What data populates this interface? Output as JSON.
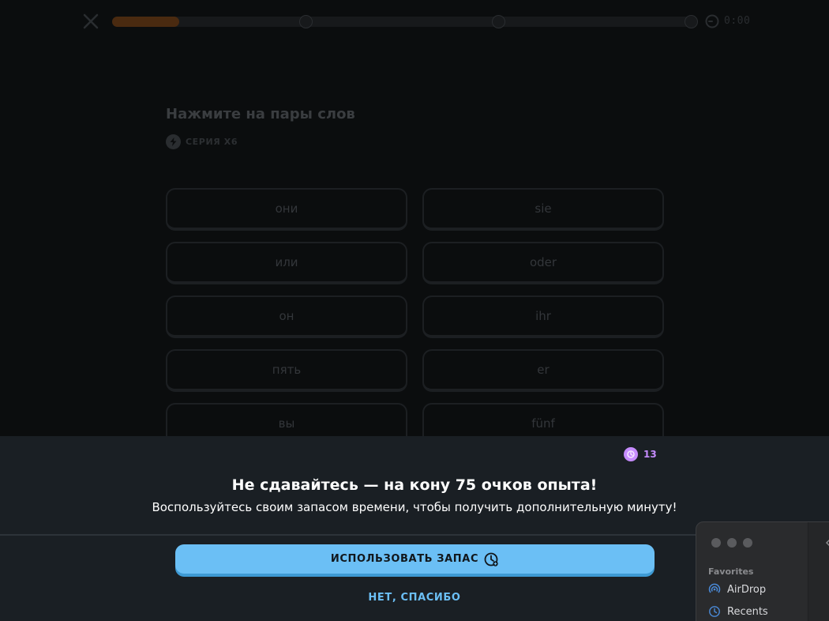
{
  "lesson": {
    "progress": 0.115,
    "timer": "0:00",
    "title": "Нажмите на пары слов",
    "streak_label": "СЕРИЯ X6",
    "tiles": [
      {
        "left": "они",
        "right": "sie"
      },
      {
        "left": "или",
        "right": "oder"
      },
      {
        "left": "он",
        "right": "ihr"
      },
      {
        "left": "пять",
        "right": "er"
      },
      {
        "left": "вы",
        "right": "fünf"
      }
    ]
  },
  "modal": {
    "gem_count": "13",
    "title": "Не сдавайтесь — на кону 75 очков опыта!",
    "subtitle": "Воспользуйтесь своим запасом времени, чтобы получить дополнительную минуту!",
    "primary_button": "ИСПОЛЬЗОВАТЬ ЗАПАС",
    "secondary_button": "НЕТ, СПАСИБО"
  },
  "finder": {
    "favorites_header": "Favorites",
    "items": [
      {
        "label": "AirDrop",
        "icon": "airdrop-icon"
      },
      {
        "label": "Recents",
        "icon": "clock-icon"
      }
    ]
  },
  "colors": {
    "accent_blue": "#6bbff5",
    "gem_purple": "#c68cff",
    "progress_orange": "#4a2a10"
  }
}
